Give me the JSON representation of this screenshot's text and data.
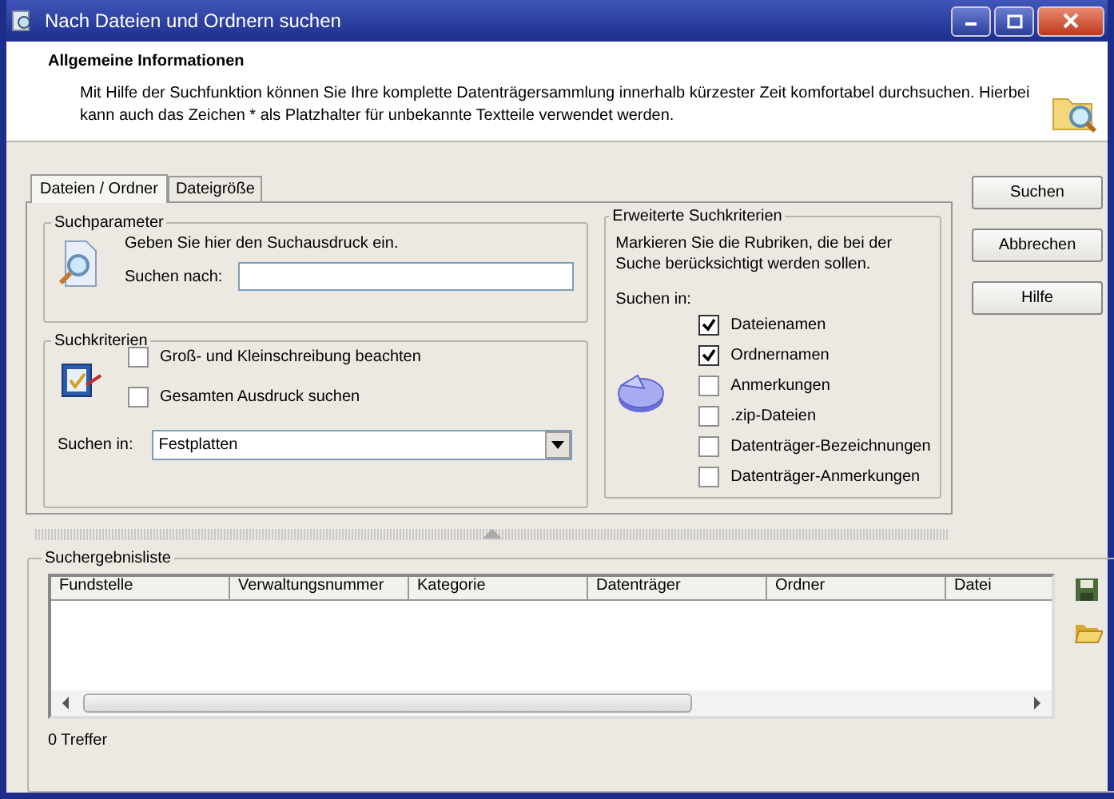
{
  "window": {
    "title": "Nach Dateien und Ordnern suchen"
  },
  "header": {
    "title": "Allgemeine Informationen",
    "text": "Mit Hilfe der Suchfunktion können Sie Ihre komplette Datenträgersammlung innerhalb kürzester Zeit komfortabel durchsuchen. Hierbei kann auch das Zeichen * als Platzhalter für unbekannte Textteile verwendet werden."
  },
  "tabs": [
    {
      "label": "Dateien / Ordner",
      "selected": true
    },
    {
      "label": "Dateigröße",
      "selected": false
    }
  ],
  "search_parameters": {
    "legend": "Suchparameter",
    "hint": "Geben Sie hier den Suchausdruck ein.",
    "label": "Suchen nach:"
  },
  "criteria": {
    "legend": "Suchkriterien",
    "options": [
      {
        "label": "Groß- und Kleinschreibung beachten",
        "checked": false
      },
      {
        "label": "Gesamten Ausdruck suchen",
        "checked": false
      }
    ],
    "scope_label": "Suchen in:",
    "scope_value": "Festplatten"
  },
  "extended": {
    "legend": "Erweiterte Suchkriterien",
    "description": "Markieren Sie die Rubriken, die bei der Suche berücksichtigt werden sollen.",
    "scope_label": "Suchen in:",
    "options": [
      {
        "label": "Dateienamen",
        "checked": true
      },
      {
        "label": "Ordnernamen",
        "checked": true
      },
      {
        "label": "Anmerkungen",
        "checked": false
      },
      {
        "label": ".zip-Dateien",
        "checked": false
      },
      {
        "label": "Datenträger-Bezeichnungen",
        "checked": false
      },
      {
        "label": "Datenträger-Anmerkungen",
        "checked": false
      }
    ]
  },
  "buttons": [
    "Suchen",
    "Abbrechen",
    "Hilfe"
  ],
  "results": {
    "legend": "Suchergebnisliste",
    "columns": [
      "Fundstelle",
      "Verwaltungsnummer",
      "Kategorie",
      "Datenträger",
      "Ordner",
      "Datei"
    ],
    "status": "0 Treffer"
  }
}
